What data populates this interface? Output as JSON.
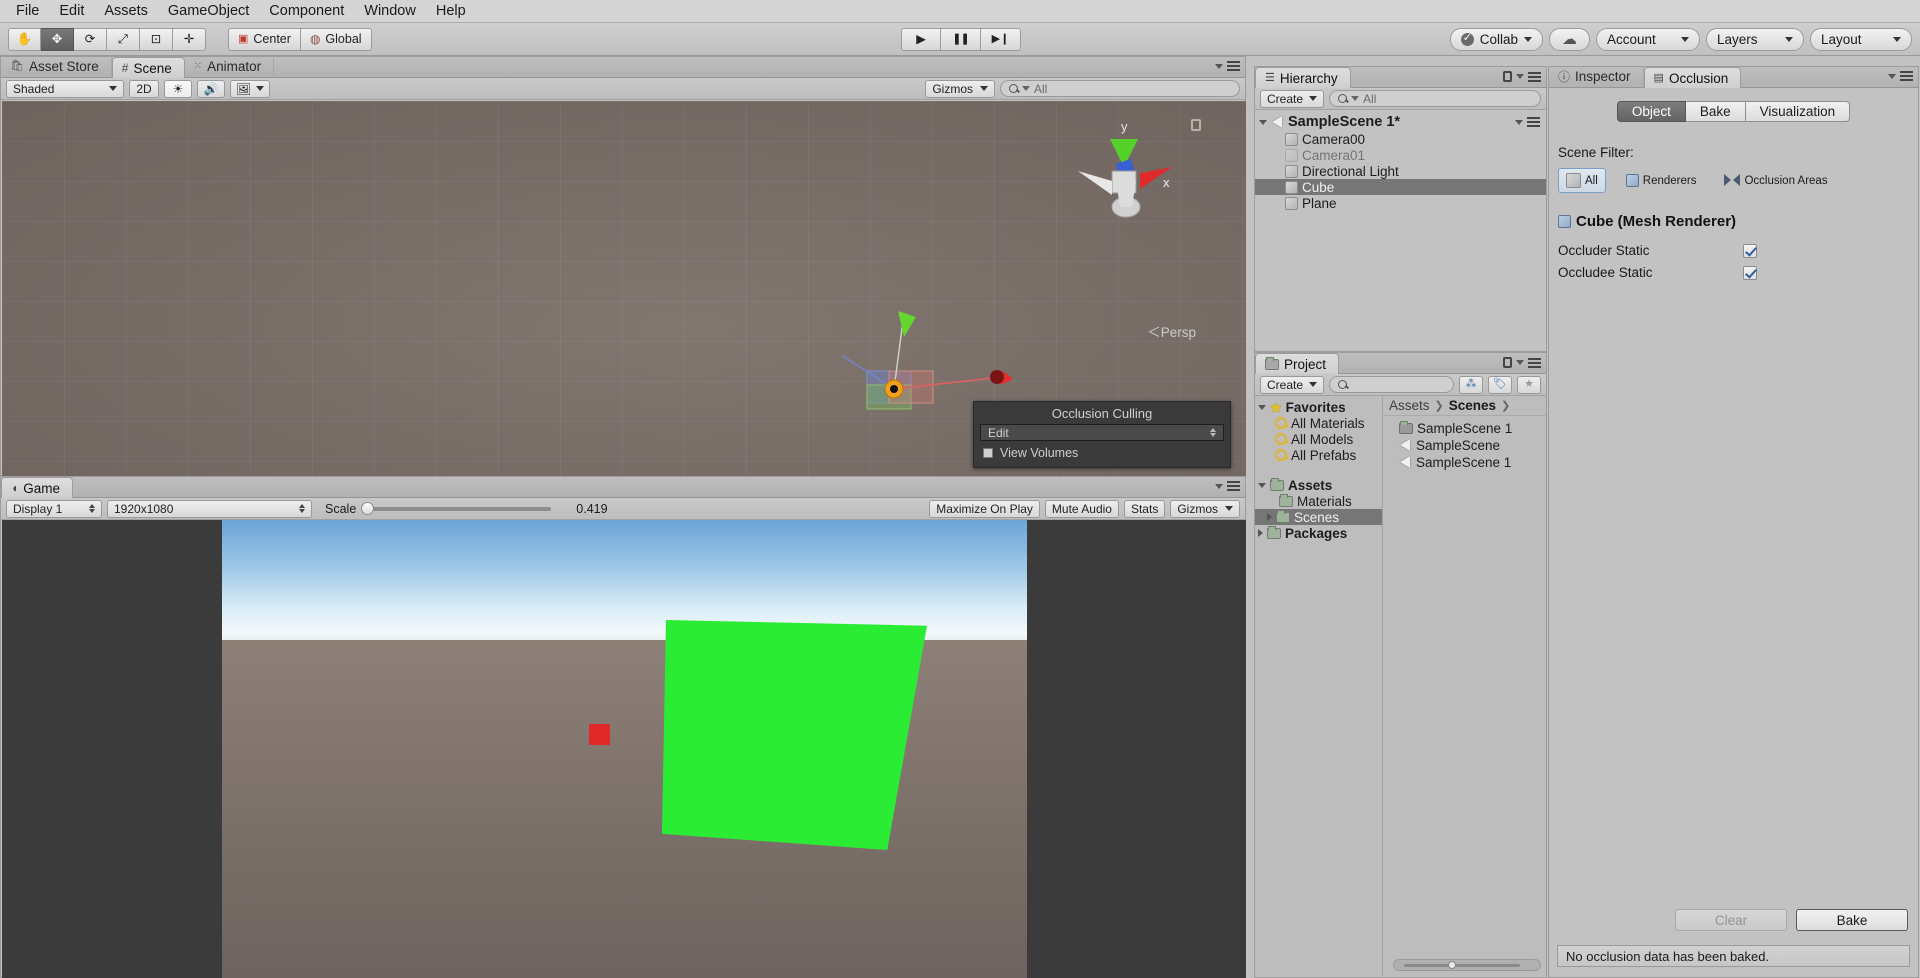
{
  "menu": {
    "items": [
      "File",
      "Edit",
      "Assets",
      "GameObject",
      "Component",
      "Window",
      "Help"
    ]
  },
  "toolbar": {
    "tools": [
      {
        "name": "hand-tool",
        "glyph": "✋"
      },
      {
        "name": "move-tool",
        "glyph": "✥"
      },
      {
        "name": "rotate-tool",
        "glyph": "⟳"
      },
      {
        "name": "scale-tool",
        "glyph": "⤢"
      },
      {
        "name": "rect-tool",
        "glyph": "⊡"
      },
      {
        "name": "transform-tool",
        "glyph": "✛"
      }
    ],
    "pivot_label": "Center",
    "space_label": "Global",
    "play_label": "▶",
    "pause_label": "❚❚",
    "step_label": "▶❙",
    "collab_label": "Collab",
    "cloud_label": "☁",
    "account_label": "Account",
    "layers_label": "Layers",
    "layout_label": "Layout"
  },
  "scene_view": {
    "tabs": [
      {
        "label": "Asset Store",
        "active": false
      },
      {
        "label": "Scene",
        "active": true
      },
      {
        "label": "Animator",
        "active": false
      }
    ],
    "shading_mode": "Shaded",
    "mode_2d": "2D",
    "gizmos_label": "Gizmos",
    "search_placeholder": "All",
    "search_value": "",
    "axis_labels": {
      "y": "y",
      "x": "x"
    },
    "persp_label": "Persp",
    "occlusion_popup": {
      "title": "Occlusion Culling",
      "dropdown_value": "Edit",
      "checkbox_label": "View Volumes",
      "checkbox_checked": false
    }
  },
  "game_view": {
    "tab_label": "Game",
    "display": "Display 1",
    "resolution": "1920x1080",
    "scale_label": "Scale",
    "scale_value": "0.419",
    "maximize_label": "Maximize On Play",
    "mute_label": "Mute Audio",
    "stats_label": "Stats",
    "gizmos_label": "Gizmos"
  },
  "hierarchy": {
    "tab_label": "Hierarchy",
    "create_label": "Create",
    "search_placeholder": "All",
    "scene_name": "SampleScene 1*",
    "objects": [
      {
        "label": "Camera00",
        "selected": false,
        "dim": false
      },
      {
        "label": "Camera01",
        "selected": false,
        "dim": true
      },
      {
        "label": "Directional Light",
        "selected": false,
        "dim": false
      },
      {
        "label": "Cube",
        "selected": true,
        "dim": false
      },
      {
        "label": "Plane",
        "selected": false,
        "dim": false
      }
    ]
  },
  "project": {
    "tab_label": "Project",
    "create_label": "Create",
    "search_placeholder": "",
    "favorites_label": "Favorites",
    "favorites": [
      "All Materials",
      "All Models",
      "All Prefabs"
    ],
    "assets_label": "Assets",
    "assets_children": [
      {
        "label": "Materials",
        "selected": false
      },
      {
        "label": "Scenes",
        "selected": true
      }
    ],
    "packages_label": "Packages",
    "breadcrumbs": [
      "Assets",
      "Scenes"
    ],
    "files": [
      {
        "label": "SampleScene 1",
        "type": "folder"
      },
      {
        "label": "SampleScene",
        "type": "scene"
      },
      {
        "label": "SampleScene 1",
        "type": "scene"
      }
    ]
  },
  "inspector": {
    "tabs": [
      {
        "label": "Inspector",
        "active": false
      },
      {
        "label": "Occlusion",
        "active": true
      }
    ],
    "segments": [
      {
        "label": "Object",
        "active": true
      },
      {
        "label": "Bake",
        "active": false
      },
      {
        "label": "Visualization",
        "active": false
      }
    ],
    "scene_filter_label": "Scene Filter:",
    "filters": [
      {
        "label": "All",
        "active": true,
        "icon": "cube-icon"
      },
      {
        "label": "Renderers",
        "active": false,
        "icon": "renderer-icon"
      },
      {
        "label": "Occlusion Areas",
        "active": false,
        "icon": "occlusion-area-icon"
      }
    ],
    "object_title": "Cube (Mesh Renderer)",
    "properties": [
      {
        "label": "Occluder Static",
        "checked": true
      },
      {
        "label": "Occludee Static",
        "checked": true
      }
    ],
    "clear_label": "Clear",
    "bake_label": "Bake",
    "status_text": "No occlusion data has been baked."
  }
}
